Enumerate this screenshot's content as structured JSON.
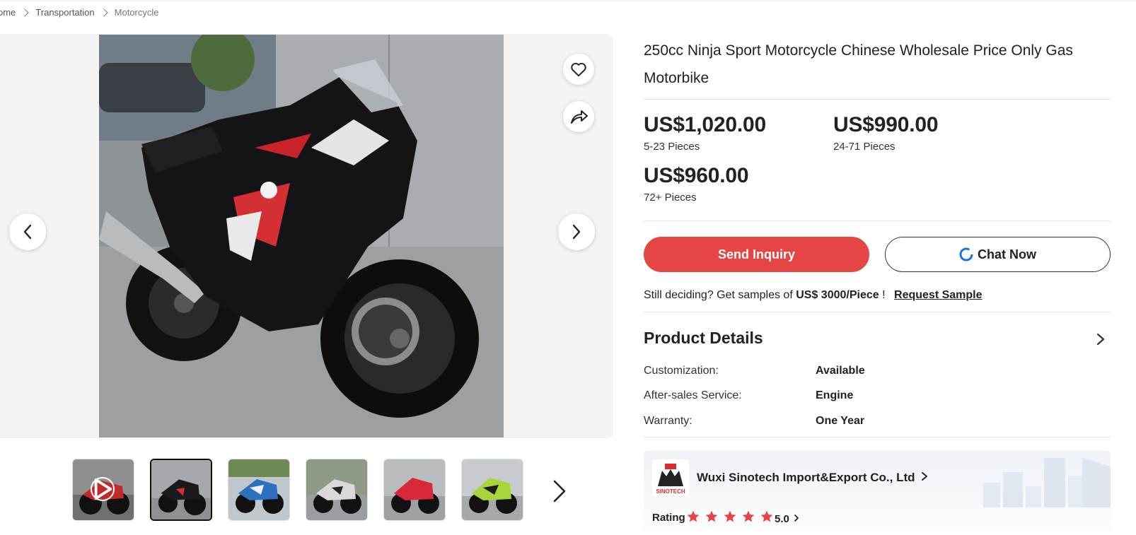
{
  "breadcrumb": {
    "items": [
      "ome",
      "Transportation",
      "Motorcycle"
    ]
  },
  "gallery": {
    "main_image": "motorcycle-photo",
    "thumbnails": [
      {
        "color": "#c22a2a",
        "has_video": true
      },
      {
        "color": "#2a2a2e",
        "active": true
      },
      {
        "color": "#2f6fbf"
      },
      {
        "color": "#9a9ea3"
      },
      {
        "color": "#d8283a"
      },
      {
        "color": "#a7d63a"
      }
    ]
  },
  "product": {
    "title": "250cc Ninja Sport Motorcycle Chinese Wholesale Price Only Gas Motorbike",
    "prices": [
      {
        "price": "US$1,020.00",
        "qty": "5-23 Pieces"
      },
      {
        "price": "US$990.00",
        "qty": "24-71 Pieces"
      },
      {
        "price": "US$960.00",
        "qty": "72+ Pieces"
      }
    ]
  },
  "actions": {
    "inquiry": "Send Inquiry",
    "chat": "Chat Now"
  },
  "sample": {
    "prefix": "Still deciding? Get samples of",
    "price": "US$ 3000/Piece",
    "suffix": "!",
    "link": "Request Sample"
  },
  "details": {
    "title": "Product Details",
    "rows": [
      {
        "label": "Customization:",
        "value": "Available"
      },
      {
        "label": "After-sales Service:",
        "value": "Engine"
      },
      {
        "label": "Warranty:",
        "value": "One Year"
      }
    ]
  },
  "supplier": {
    "name": "Wuxi Sinotech Import&Export Co., Ltd",
    "logo_text": "SINOTECH",
    "rating_label": "Rating",
    "rating": 5,
    "score": "5.0"
  },
  "colors": {
    "accent": "#e64545",
    "star": "#e64545",
    "chat_icon": "#1a73e8"
  }
}
